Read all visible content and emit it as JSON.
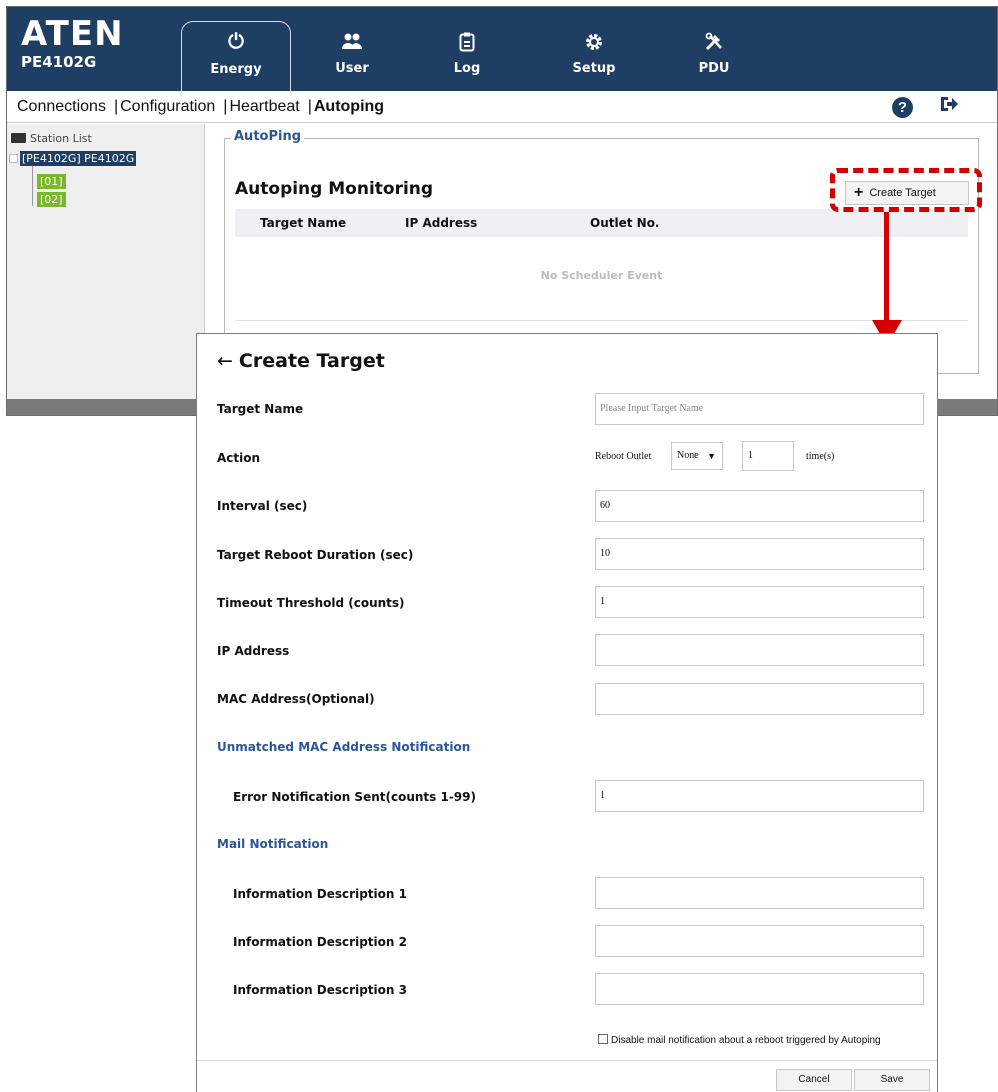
{
  "brand": {
    "name": "ATEN",
    "model": "PE4102G"
  },
  "nav": [
    {
      "label": "Energy",
      "icon": "power-icon"
    },
    {
      "label": "User",
      "icon": "users-icon"
    },
    {
      "label": "Log",
      "icon": "clipboard-icon"
    },
    {
      "label": "Setup",
      "icon": "gear-icon"
    },
    {
      "label": "PDU",
      "icon": "tools-icon"
    }
  ],
  "subnav": {
    "connections": "Connections",
    "configuration": "Configuration",
    "heartbeat": "Heartbeat",
    "autoping": "Autoping",
    "separator": "|",
    "help_glyph": "?"
  },
  "sidebar": {
    "title": "Station List",
    "root": "[PE4102G] PE4102G",
    "children": [
      "[01]",
      "[02]"
    ]
  },
  "autoping": {
    "legend": "AutoPing",
    "title": "Autoping Monitoring",
    "create_label": "Create Target",
    "columns": [
      "Target Name",
      "IP Address",
      "Outlet No."
    ],
    "empty_message": "No Scheduler Event"
  },
  "dialog": {
    "title": "Create Target",
    "target_name": {
      "label": "Target Name",
      "placeholder": "Please Input Target Name"
    },
    "action": {
      "label": "Action",
      "prefix": "Reboot Outlet",
      "outlet": "None",
      "times": "1",
      "suffix": "time(s)"
    },
    "interval": {
      "label": "Interval (sec)",
      "value": "60"
    },
    "reboot_duration": {
      "label": "Target Reboot Duration (sec)",
      "value": "10"
    },
    "timeout": {
      "label": "Timeout Threshold (counts)",
      "value": "1"
    },
    "ip": {
      "label": "IP Address",
      "value": ""
    },
    "mac": {
      "label": "MAC Address(Optional)",
      "value": ""
    },
    "unmatched_section": "Unmatched MAC Address Notification",
    "error_sent": {
      "label": "Error Notification Sent(counts 1-99)",
      "value": "1"
    },
    "mail_section": "Mail Notification",
    "info1": {
      "label": "Information Description 1",
      "value": ""
    },
    "info2": {
      "label": "Information Description 2",
      "value": ""
    },
    "info3": {
      "label": "Information Description 3",
      "value": ""
    },
    "disable_mail": "Disable mail notification about a reboot triggered by Autoping",
    "cancel": "Cancel",
    "save": "Save"
  },
  "colors": {
    "header": "#1f3e64",
    "accent_text": "#2b5797",
    "highlight": "#d40000",
    "outlet_badge": "#79b82a"
  }
}
